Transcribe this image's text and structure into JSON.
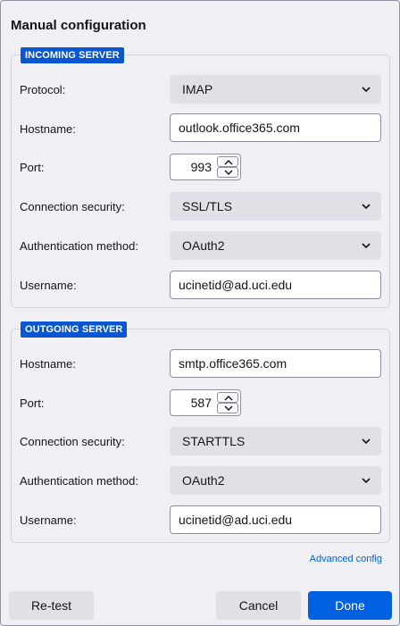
{
  "title": "Manual configuration",
  "incoming": {
    "legend": "INCOMING SERVER",
    "protocol_label": "Protocol:",
    "protocol_value": "IMAP",
    "hostname_label": "Hostname:",
    "hostname_value": "outlook.office365.com",
    "port_label": "Port:",
    "port_value": "993",
    "security_label": "Connection security:",
    "security_value": "SSL/TLS",
    "auth_label": "Authentication method:",
    "auth_value": "OAuth2",
    "username_label": "Username:",
    "username_value": "ucinetid@ad.uci.edu"
  },
  "outgoing": {
    "legend": "OUTGOING SERVER",
    "hostname_label": "Hostname:",
    "hostname_value": "smtp.office365.com",
    "port_label": "Port:",
    "port_value": "587",
    "security_label": "Connection security:",
    "security_value": "STARTTLS",
    "auth_label": "Authentication method:",
    "auth_value": "OAuth2",
    "username_label": "Username:",
    "username_value": "ucinetid@ad.uci.edu"
  },
  "advanced_link": "Advanced config",
  "buttons": {
    "retest": "Re-test",
    "cancel": "Cancel",
    "done": "Done"
  },
  "colors": {
    "accent": "#0061e0",
    "legend_bg": "#0a55d0",
    "link": "#0060df"
  }
}
